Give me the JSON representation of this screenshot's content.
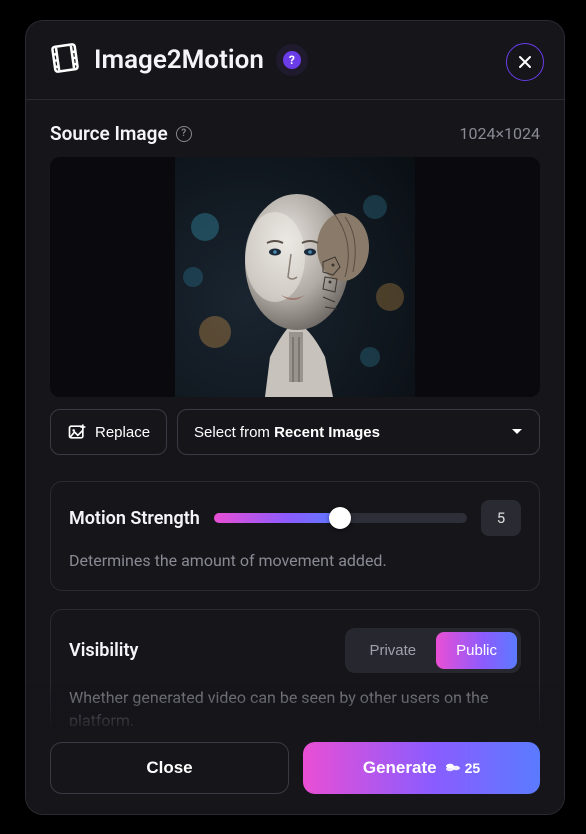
{
  "header": {
    "title": "Image2Motion",
    "help_glyph": "?"
  },
  "source": {
    "label": "Source Image",
    "dimensions": "1024×1024",
    "replace_label": "Replace",
    "select_prefix": "Select from ",
    "select_bold": "Recent Images"
  },
  "motion": {
    "label": "Motion Strength",
    "value": "5",
    "desc": "Determines the amount of movement added."
  },
  "visibility": {
    "label": "Visibility",
    "private": "Private",
    "public": "Public",
    "desc": "Whether generated video can be seen by other users on the platform."
  },
  "footer": {
    "close": "Close",
    "generate": "Generate",
    "credits": "25"
  }
}
